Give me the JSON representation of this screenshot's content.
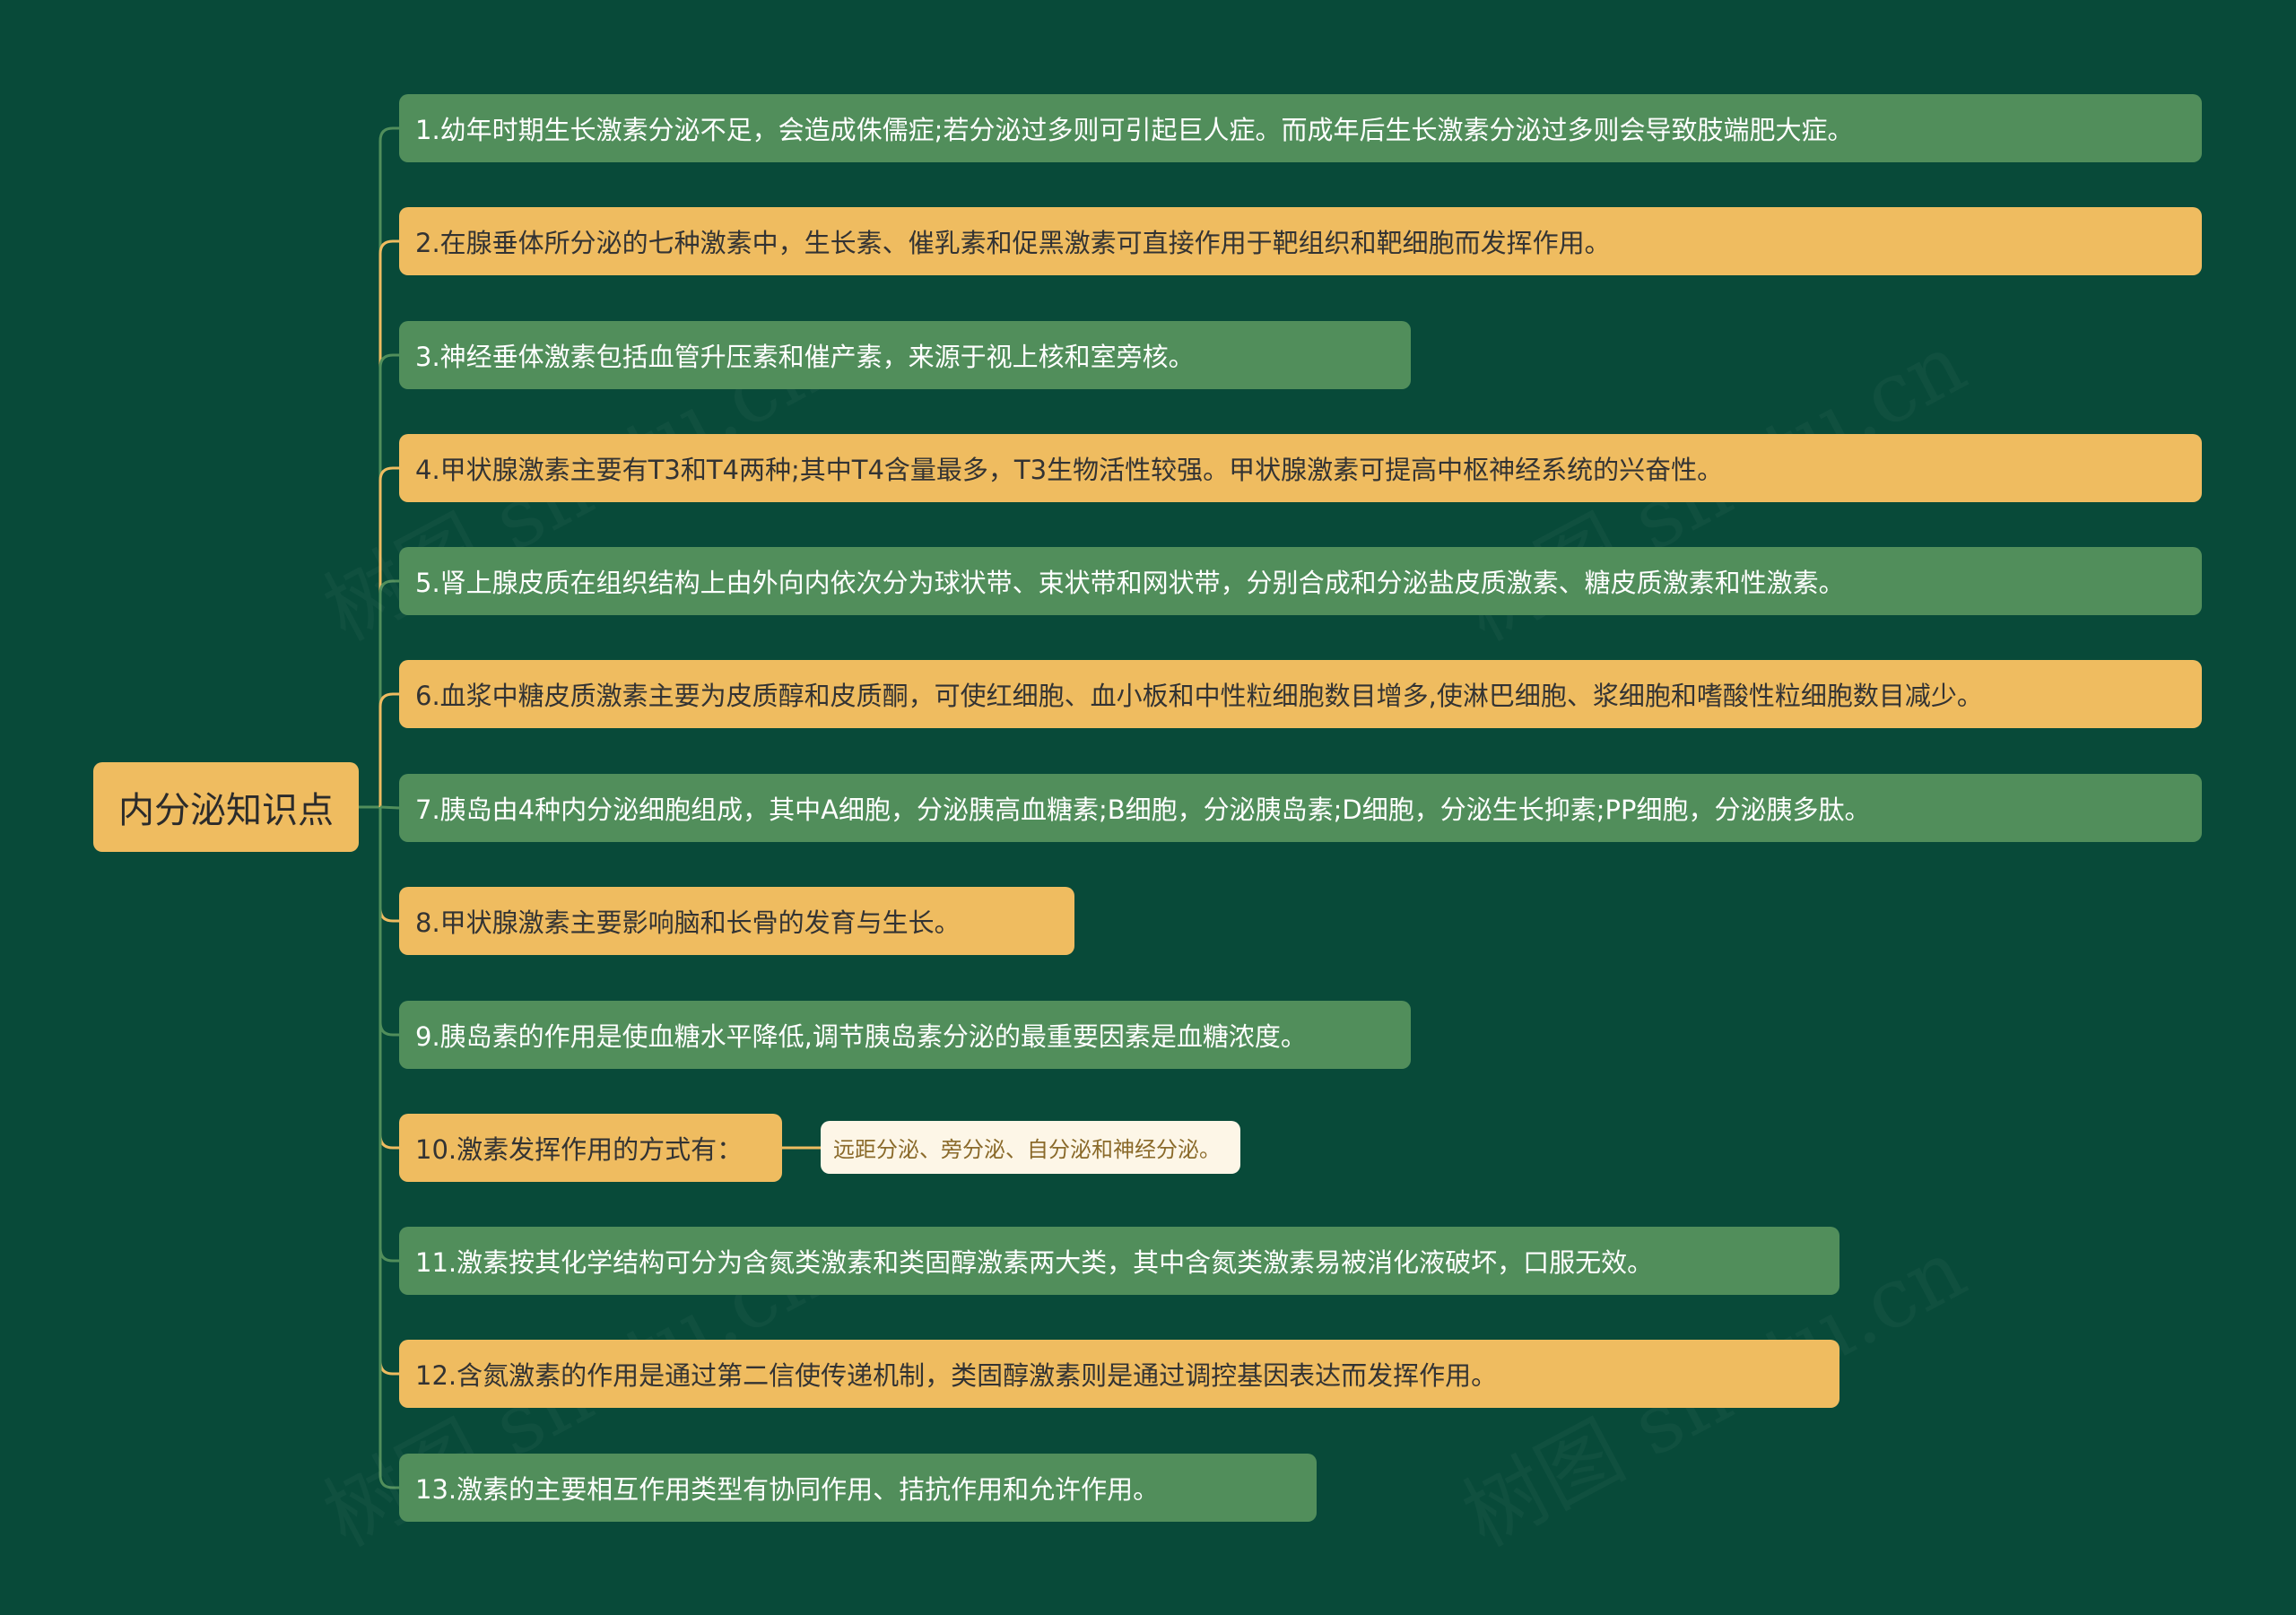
{
  "root": {
    "label": "内分泌知识点"
  },
  "nodes": [
    {
      "label": "1.幼年时期生长激素分泌不足，会造成侏儒症;若分泌过多则可引起巨人症。而成年后生长激素分泌过多则会导致肢端肥大症。",
      "color": "green"
    },
    {
      "label": "2.在腺垂体所分泌的七种激素中，生长素、催乳素和促黑激素可直接作用于靶组织和靶细胞而发挥作用。",
      "color": "yellow"
    },
    {
      "label": "3.神经垂体激素包括血管升压素和催产素，来源于视上核和室旁核。",
      "color": "green"
    },
    {
      "label": "4.甲状腺激素主要有T3和T4两种;其中T4含量最多，T3生物活性较强。甲状腺激素可提高中枢神经系统的兴奋性。",
      "color": "yellow"
    },
    {
      "label": "5.肾上腺皮质在组织结构上由外向内依次分为球状带、束状带和网状带，分别合成和分泌盐皮质激素、糖皮质激素和性激素。",
      "color": "green"
    },
    {
      "label": "6.血浆中糖皮质激素主要为皮质醇和皮质酮，可使红细胞、血小板和中性粒细胞数目增多,使淋巴细胞、浆细胞和嗜酸性粒细胞数目减少。",
      "color": "yellow"
    },
    {
      "label": "7.胰岛由4种内分泌细胞组成，其中A细胞，分泌胰高血糖素;B细胞，分泌胰岛素;D细胞，分泌生长抑素;PP细胞，分泌胰多肽。",
      "color": "green"
    },
    {
      "label": "8.甲状腺激素主要影响脑和长骨的发育与生长。",
      "color": "yellow"
    },
    {
      "label": "9.胰岛素的作用是使血糖水平降低,调节胰岛素分泌的最重要因素是血糖浓度。",
      "color": "green"
    },
    {
      "label": "10.激素发挥作用的方式有：",
      "color": "yellow"
    },
    {
      "label": "11.激素按其化学结构可分为含氮类激素和类固醇激素两大类，其中含氮类激素易被消化液破坏，口服无效。",
      "color": "green"
    },
    {
      "label": "12.含氮激素的作用是通过第二信使传递机制，类固醇激素则是通过调控基因表达而发挥作用。",
      "color": "yellow"
    },
    {
      "label": "13.激素的主要相互作用类型有协同作用、拮抗作用和允许作用。",
      "color": "green"
    }
  ],
  "leaf": {
    "label": "远距分泌、旁分泌、自分泌和神经分泌。"
  },
  "watermark": {
    "text": "树图 shutu.cn"
  },
  "colors": {
    "background": "#084a39",
    "green": "#518e5b",
    "yellow": "#efbc60",
    "leaf": "#fdf6e7"
  }
}
